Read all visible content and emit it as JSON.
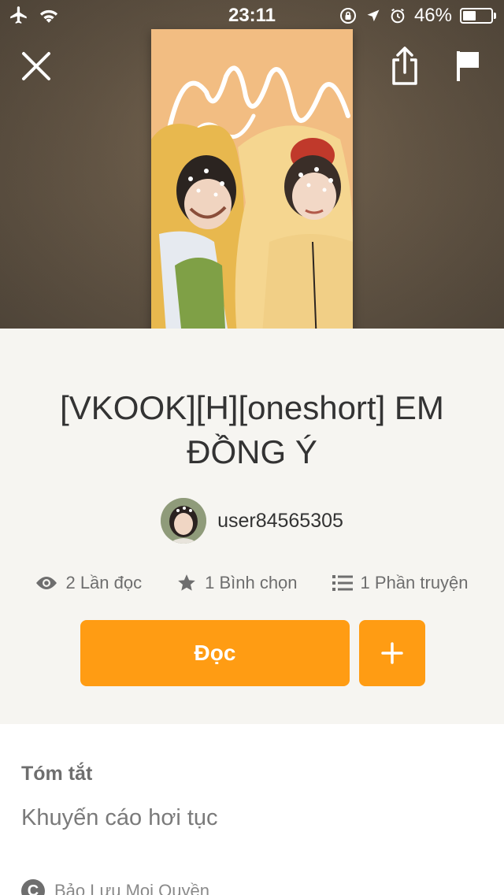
{
  "status_bar": {
    "time": "23:11",
    "battery_percent": "46%",
    "battery_level": 0.46,
    "icons": [
      "airplane-icon",
      "wifi-icon",
      "orientation-lock-icon",
      "location-icon",
      "alarm-icon",
      "battery-icon"
    ]
  },
  "header": {
    "icons": [
      "close-icon",
      "share-icon",
      "flag-icon"
    ]
  },
  "story": {
    "title": "[VKOOK][H][oneshort] EM ĐỒNG Ý",
    "author": "user84565305",
    "stats": {
      "reads": "2 Lần đọc",
      "votes": "1 Bình chọn",
      "parts": "1 Phần truyện"
    },
    "read_label": "Đọc"
  },
  "summary": {
    "label": "Tóm tắt",
    "text": "Khuyến cáo hơi tục",
    "copyright": "Bảo Lưu Mọi Quyền"
  },
  "colors": {
    "accent": "#ff9c13",
    "panel_bg": "#f6f5f1",
    "title_text": "#333333"
  }
}
